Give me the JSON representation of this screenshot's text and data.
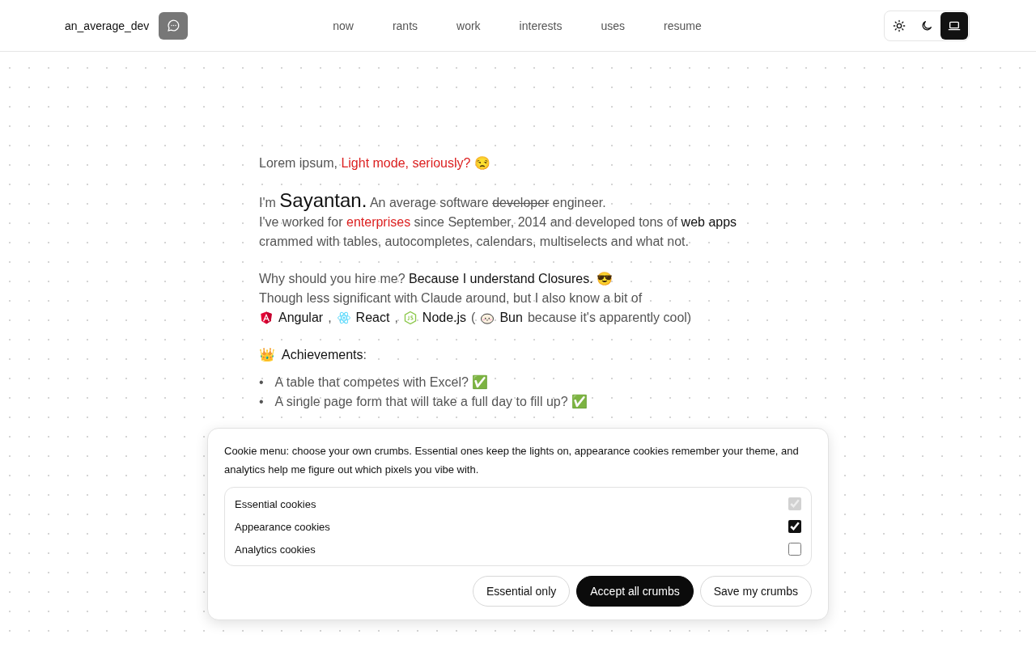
{
  "header": {
    "site_name": "an_average_dev",
    "nav": [
      {
        "label": "now",
        "selected": false
      },
      {
        "label": "rants",
        "selected": false
      },
      {
        "label": "work",
        "selected": false
      },
      {
        "label": "interests",
        "selected": false
      },
      {
        "label": "uses",
        "selected": false
      },
      {
        "label": "resume",
        "selected": false
      }
    ],
    "theme_options": [
      {
        "kind": "light",
        "selected": false
      },
      {
        "kind": "dark",
        "selected": false
      },
      {
        "kind": "system",
        "selected": true
      }
    ]
  },
  "intro": [
    [
      {
        "kind": "para",
        "segments": [
          {
            "kind": "text",
            "text": "Lorem ipsum, "
          },
          {
            "kind": "accent",
            "text": "Light mode, seriously?"
          },
          {
            "kind": "text",
            "text": " 😒"
          }
        ]
      }
    ],
    [
      {
        "kind": "para",
        "segments": [
          {
            "kind": "text",
            "text": "I'm "
          },
          {
            "kind": "name",
            "text": "Sayantan."
          },
          {
            "kind": "text",
            "text": " An average software "
          },
          {
            "kind": "strike",
            "text": "developer"
          },
          {
            "kind": "text",
            "text": " engineer."
          }
        ]
      },
      {
        "kind": "para",
        "segments": [
          {
            "kind": "text",
            "text": "I've worked for "
          },
          {
            "kind": "accent",
            "text": "enterprises"
          },
          {
            "kind": "text",
            "text": " since September, 2014 and developed tons of "
          },
          {
            "kind": "strong",
            "text": "web apps"
          },
          {
            "kind": "text",
            "text": " crammed with tables, autocompletes, calendars, multiselects and what not."
          }
        ]
      }
    ],
    [
      {
        "kind": "para",
        "segments": [
          {
            "kind": "text",
            "text": "Why should you hire me? "
          },
          {
            "kind": "strong",
            "text": "Because I understand Closures."
          },
          {
            "kind": "text",
            "text": " 😎"
          }
        ]
      },
      {
        "kind": "para",
        "segments": [
          {
            "kind": "text",
            "text": "Though less significant with Claude around, but I also know a bit of"
          }
        ]
      },
      {
        "kind": "techline",
        "segments": [
          {
            "kind": "tech",
            "text": "Angular"
          },
          {
            "kind": "text",
            "text": ","
          },
          {
            "kind": "tech",
            "text": "React"
          },
          {
            "kind": "text",
            "text": ","
          },
          {
            "kind": "tech",
            "text": "Node.js"
          },
          {
            "kind": "text",
            "text": "("
          },
          {
            "kind": "tech",
            "text": "Bun"
          },
          {
            "kind": "text",
            "text": "because it's apparently cool)"
          }
        ]
      }
    ],
    [
      {
        "kind": "heading",
        "segments": [
          {
            "kind": "text",
            "text": "👑"
          },
          {
            "kind": "strong",
            "text": "Achievements"
          },
          {
            "kind": "text",
            "text": ":"
          }
        ]
      },
      {
        "kind": "list",
        "items": [
          {
            "marker": "•",
            "text": "A table that competes with Excel? ✅"
          },
          {
            "marker": "•",
            "text": "A single page form that will take a full day to fill up? ✅"
          }
        ]
      }
    ]
  ],
  "cookie_dialog": {
    "message": "Cookie menu: choose your own crumbs. Essential ones keep the lights on, appearance cookies remember your theme, and analytics help me figure out which pixels you vibe with.",
    "options": [
      {
        "label": "Essential cookies",
        "checked": true,
        "disabled": true
      },
      {
        "label": "Appearance cookies",
        "checked": true,
        "disabled": false
      },
      {
        "label": "Analytics cookies",
        "checked": false,
        "disabled": false
      }
    ],
    "buttons": [
      {
        "label": "Essential only",
        "kind": "outline"
      },
      {
        "label": "Accept all crumbs",
        "kind": "primary"
      },
      {
        "label": "Save my crumbs",
        "kind": "outline"
      }
    ]
  }
}
